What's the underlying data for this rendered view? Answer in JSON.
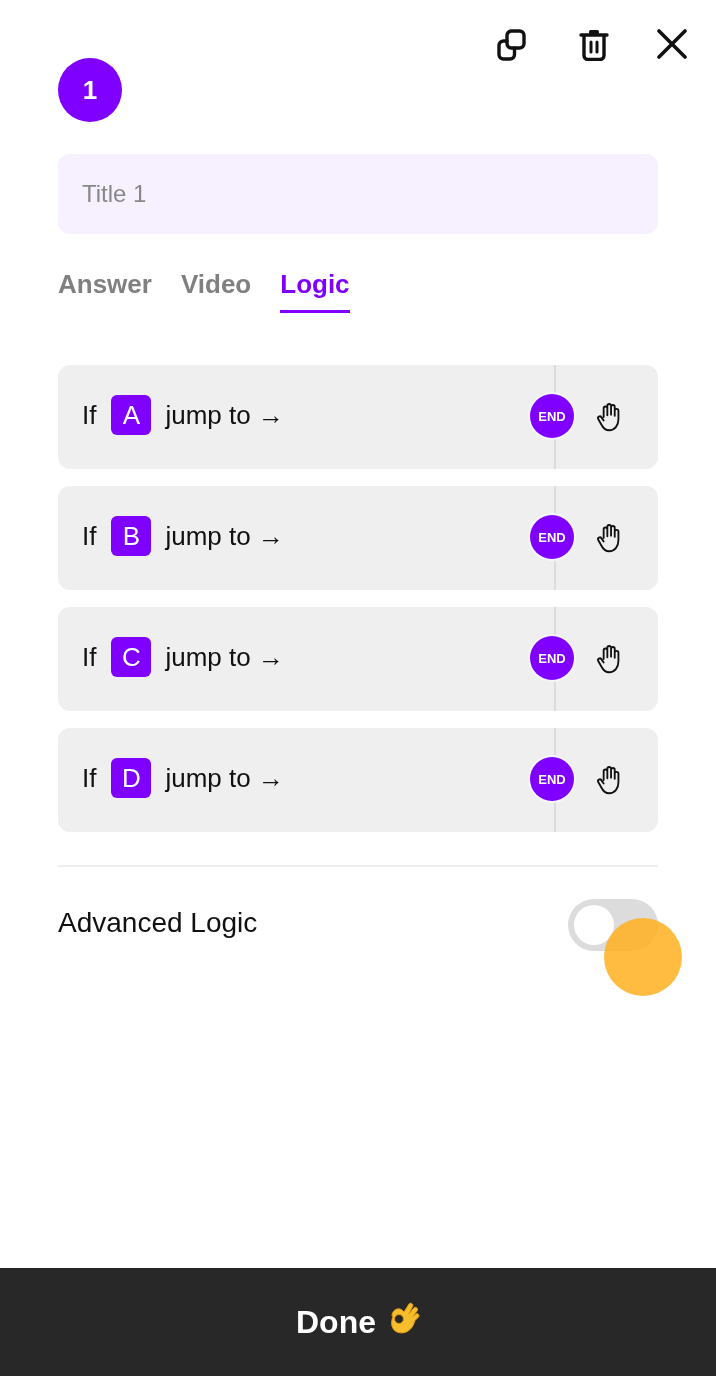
{
  "question": {
    "number": "1"
  },
  "title_field": {
    "placeholder": "Title 1"
  },
  "tabs": [
    {
      "label": "Answer",
      "selected": false
    },
    {
      "label": "Video",
      "selected": false
    },
    {
      "label": "Logic",
      "selected": true
    }
  ],
  "logic_rules": [
    {
      "prefix": "If",
      "option": "A",
      "action": "jump to →",
      "target": "END"
    },
    {
      "prefix": "If",
      "option": "B",
      "action": "jump to →",
      "target": "END"
    },
    {
      "prefix": "If",
      "option": "C",
      "action": "jump to →",
      "target": "END"
    },
    {
      "prefix": "If",
      "option": "D",
      "action": "jump to →",
      "target": "END"
    }
  ],
  "advanced_logic": {
    "label": "Advanced Logic",
    "on": false
  },
  "done_button": {
    "label": "Done"
  }
}
